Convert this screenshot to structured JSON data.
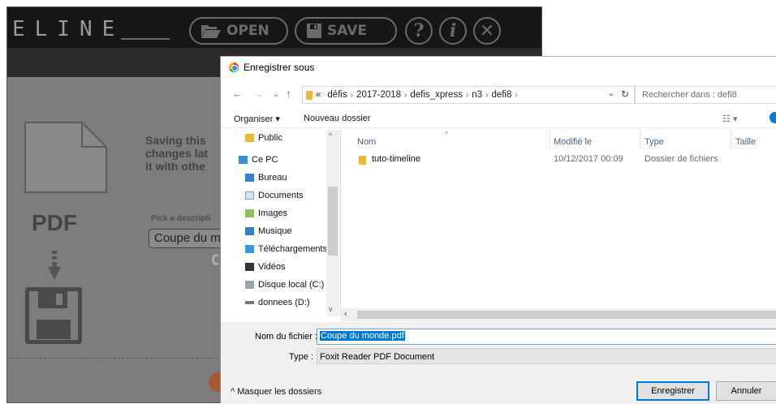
{
  "app": {
    "logo": "ELINE",
    "toolbar": {
      "open_label": "OPEN",
      "save_label": "SAVE",
      "help_glyph": "?",
      "info_glyph": "i",
      "close_glyph": "✕"
    },
    "save_panel": {
      "lines": [
        "Saving this",
        "changes lat",
        "it with othe"
      ],
      "pdf_label": "PDF",
      "description_label": "Pick a descripti",
      "description_value": "Coupe du m"
    }
  },
  "dialog": {
    "title": "Enregistrer sous",
    "breadcrumb": [
      "«",
      "défis",
      "2017-2018",
      "defis_xpress",
      "n3",
      "defi8"
    ],
    "search_placeholder": "Rechercher dans : defi8",
    "organize_label": "Organiser ▾",
    "new_folder_label": "Nouveau dossier",
    "tree": [
      {
        "label": "Public",
        "icon": "folder-icon"
      },
      {
        "label": "Ce PC",
        "icon": "computer-icon"
      },
      {
        "label": "Bureau",
        "icon": "desktop-icon"
      },
      {
        "label": "Documents",
        "icon": "documents-icon"
      },
      {
        "label": "Images",
        "icon": "images-icon"
      },
      {
        "label": "Musique",
        "icon": "music-icon"
      },
      {
        "label": "Téléchargements",
        "icon": "downloads-icon"
      },
      {
        "label": "Vidéos",
        "icon": "videos-icon"
      },
      {
        "label": "Disque local (C:)",
        "icon": "drive-icon"
      },
      {
        "label": "donnees (D:)",
        "icon": "drive-icon"
      }
    ],
    "columns": [
      "Nom",
      "Modifié le",
      "Type",
      "Taille"
    ],
    "files": [
      {
        "name": "tuto-timeline",
        "modified": "10/12/2017 00:09",
        "type": "Dossier de fichiers",
        "size": ""
      }
    ],
    "filename_label": "Nom du fichier :",
    "filename_value": "Coupe du monde.pdf",
    "type_label": "Type :",
    "type_value": "Foxit Reader PDF Document",
    "hide_folders_label": "Masquer les dossiers",
    "save_button": "Enregistrer",
    "cancel_button": "Annuler"
  },
  "colors": {
    "accent": "#0078d7",
    "folder": "#e8b93b",
    "app_bg": "#7d7d7d",
    "app_bar": "#161616"
  }
}
